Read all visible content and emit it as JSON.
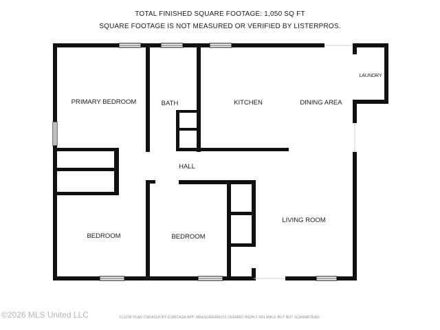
{
  "header": {
    "line1": "TOTAL FINISHED SQUARE FOOTAGE: 1,050 SQ FT",
    "line2": "SQUARE FOOTAGE IS NOT MEASURED OR VERIFIED BY LISTERPROS."
  },
  "rooms": {
    "primary_bedroom": "PRIMARY BEDROOM",
    "bath": "BATH",
    "kitchen": "KITCHEN",
    "dining_area": "DINING AREA",
    "laundry": "LAUNDRY",
    "hall": "HALL",
    "living_room": "LIVING ROOM",
    "bedroom_left": "BEDROOM",
    "bedroom_center": "BEDROOM"
  },
  "footer": {
    "note": "FLOOR PLAN CREATED BY CUBICASA APP. MEASUREMENTS DEEMED HIGHLY RELIABLE BUT NOT GUARANTEED.",
    "watermark": "©2026 MLS United LLC"
  },
  "colors": {
    "wall": "#111111",
    "window": "#ffffff",
    "background": "#ffffff"
  }
}
